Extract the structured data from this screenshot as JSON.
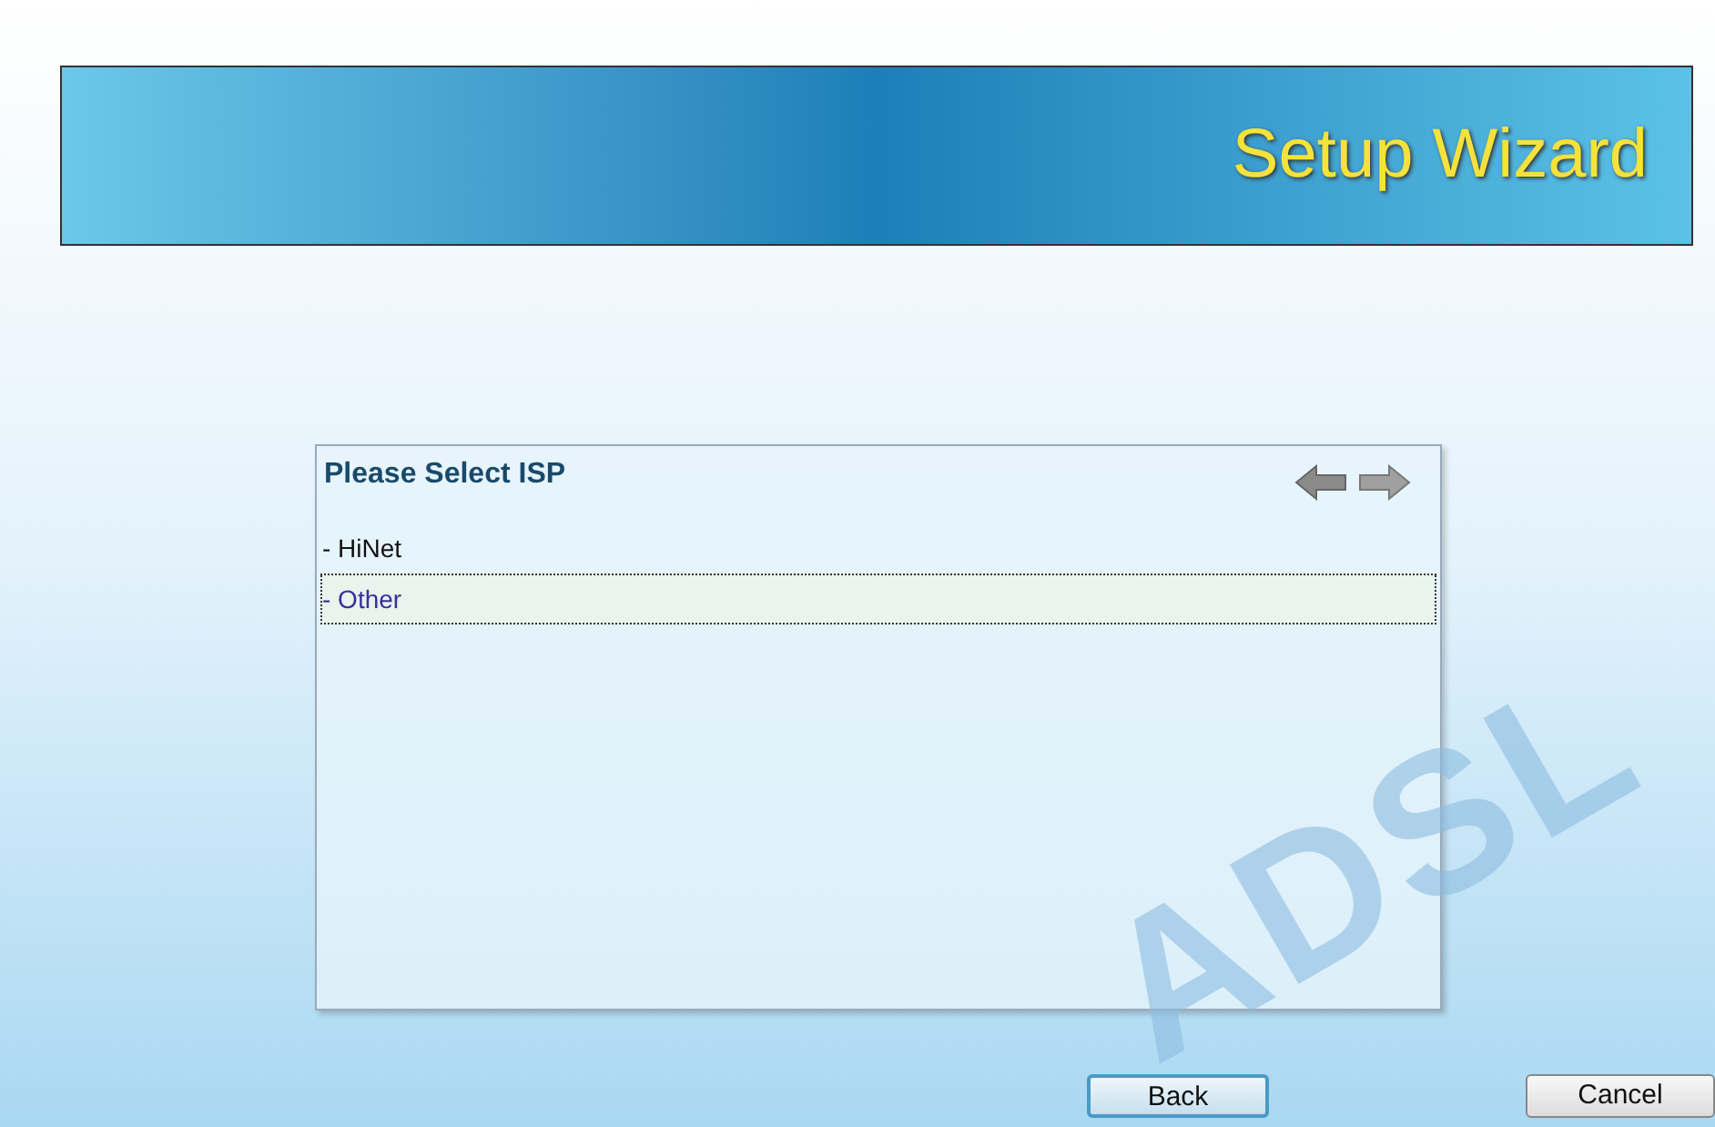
{
  "banner": {
    "title": "Setup Wizard"
  },
  "panel": {
    "title": "Please Select ISP",
    "items": [
      {
        "label": "- HiNet",
        "selected": false
      },
      {
        "label": "- Other",
        "selected": true
      }
    ]
  },
  "background_logo": "ADSL",
  "buttons": [
    {
      "label": "Back",
      "kind": "primary"
    },
    {
      "label": "Cancel",
      "kind": "secondary"
    }
  ]
}
